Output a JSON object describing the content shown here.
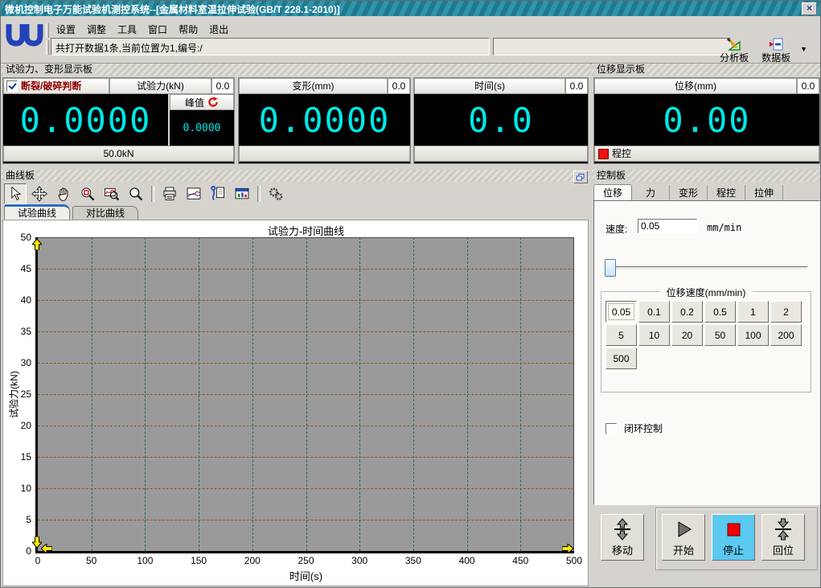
{
  "window": {
    "title": "微机控制电子万能试验机测控系统--[金属材料室温拉伸试验(GB/T 228.1-2010)]",
    "close_glyph": "×"
  },
  "menu": {
    "items": [
      "设置",
      "调整",
      "工具",
      "窗口",
      "帮助",
      "退出"
    ]
  },
  "statusbar": {
    "message": "共打开数据1条,当前位置为1,编号:/",
    "secondary": ""
  },
  "toolbar": {
    "analysis_label": "分析板",
    "data_label": "数据板",
    "more_glyph": "▼"
  },
  "display_panels": {
    "caption_left": "试验力、变形显示板",
    "caption_right": "位移显示板",
    "force": {
      "break_label": "断裂/破碎判断",
      "break_checked": true,
      "title": "试验力(kN)",
      "aux_value": "0.0",
      "value": "0.0000",
      "peak_label": "峰值",
      "peak_value": "0.0000",
      "range_label": "50.0kN"
    },
    "deform": {
      "title": "变形(mm)",
      "aux_value": "0.0",
      "value": "0.0000"
    },
    "time": {
      "title": "时间(s)",
      "aux_value": "0.0",
      "value": "0.0"
    },
    "displacement": {
      "title": "位移(mm)",
      "aux_value": "0.0",
      "value": "0.00",
      "mode_label": "程控"
    }
  },
  "curve_panel": {
    "caption": "曲线板",
    "tabs": [
      {
        "label": "试验曲线",
        "active": true
      },
      {
        "label": "对比曲线",
        "active": false
      }
    ],
    "tools": [
      "cursor",
      "move",
      "pan",
      "zoom-rect",
      "zoom-curve",
      "magnifier",
      "print",
      "curves",
      "clip-page",
      "data-window",
      "gears"
    ],
    "tool_separators": [
      5,
      9
    ]
  },
  "chart_data": {
    "type": "line",
    "title": "试验力-时间曲线",
    "xlabel": "时间(s)",
    "ylabel": "试验力(kN)",
    "xlim": [
      0,
      500
    ],
    "ylim": [
      0,
      50
    ],
    "x_ticks": [
      0,
      50,
      100,
      150,
      200,
      250,
      300,
      350,
      400,
      450,
      500
    ],
    "y_ticks": [
      0,
      5,
      10,
      15,
      20,
      25,
      30,
      35,
      40,
      45,
      50
    ],
    "grid": true,
    "legend": false,
    "plot_bg": "#9a9a9a",
    "h_grid_color": "#8a5a1e",
    "v_grid_color": "#1f6a5e",
    "series": [
      {
        "name": "试验力",
        "x": [],
        "y": []
      }
    ]
  },
  "control_panel": {
    "caption": "控制板",
    "tabs": [
      {
        "label": "位移",
        "active": true
      },
      {
        "label": "力",
        "active": false
      },
      {
        "label": "变形",
        "active": false
      },
      {
        "label": "程控",
        "active": false
      },
      {
        "label": "拉伸",
        "active": false
      }
    ],
    "speed_label": "速度:",
    "speed_value": "0.05",
    "speed_unit": "mm/min",
    "speed_group_title": "位移速度(mm/min)",
    "speed_options": [
      "0.05",
      "0.1",
      "0.2",
      "0.5",
      "1",
      "2",
      "5",
      "10",
      "20",
      "50",
      "100",
      "200",
      "500"
    ],
    "active_speed": "0.05",
    "closed_loop_label": "闭环控制",
    "closed_loop_checked": false,
    "jog_button": "移动",
    "start_button": "开始",
    "stop_button": "停止",
    "home_button": "回位"
  },
  "colors": {
    "titlebar_teal": "#20808f",
    "digital_cyan": "#00e8e8",
    "display_black": "#000000",
    "stop_active_bg": "#5bc9f0",
    "stop_red": "#f00000",
    "break_text": "#8b0000",
    "logo_blue": "#2543b8",
    "plot_gray": "#9a9a9a",
    "h_grid": "#8a5a1e",
    "v_grid": "#1f6a5e",
    "marker_yellow": "#ffe800"
  }
}
